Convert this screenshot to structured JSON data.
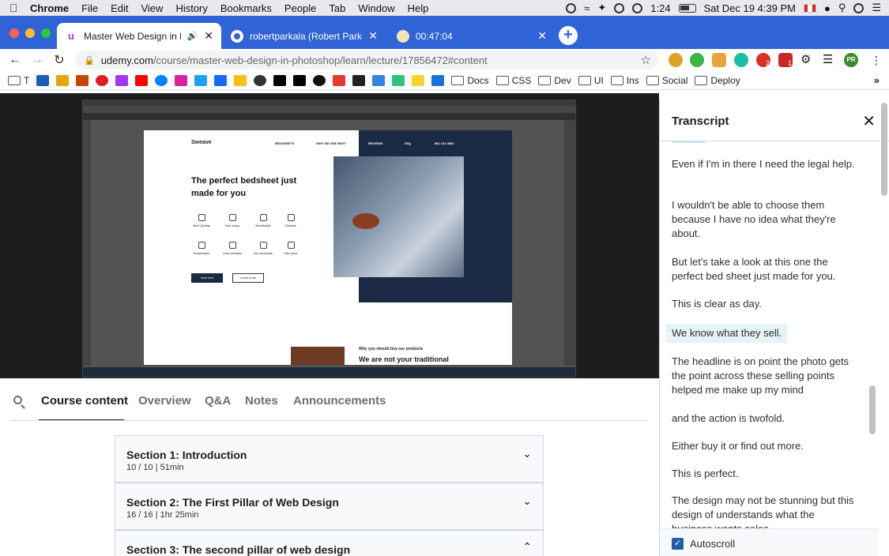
{
  "menubar": {
    "app": "Chrome",
    "items": [
      "File",
      "Edit",
      "View",
      "History",
      "Bookmarks",
      "People",
      "Tab",
      "Window",
      "Help"
    ],
    "timer": "1:24",
    "clock": "Sat Dec 19  4:39 PM"
  },
  "tabs": [
    {
      "title": "Master Web Design in Pho",
      "active": true
    },
    {
      "title": "robertparkala (Robert Parkala)",
      "active": false
    },
    {
      "title": "00:47:04",
      "active": false
    }
  ],
  "address": {
    "host": "udemy.com",
    "path": "/course/master-web-design-in-photoshop/learn/lecture/17856472#content"
  },
  "extensions": {
    "profile_badge": "PR",
    "badge_count_1": "2",
    "badge_count_2": "1"
  },
  "bookmarks": {
    "first": "T",
    "folders": [
      "Docs",
      "CSS",
      "Dev",
      "UI",
      "Ins",
      "Social",
      "Deploy"
    ],
    "more": "»"
  },
  "video": {
    "canvas": {
      "logo": "Sweave",
      "nav": [
        "BEDSHEETS",
        "WHY WE ARE BEST",
        "REVIEWS",
        "FAQ",
        "861 123 4562"
      ],
      "headline": "The perfect bedsheet just made for you",
      "features": [
        "Best Quality",
        "Non-shiny",
        "Breathable",
        "Durable",
        "Sustainable",
        "Less wrinkles",
        "No chemicals",
        "Fair price"
      ],
      "primary_button": "SHOP NOW",
      "secondary_button": "LEARN MORE",
      "sub_eyebrow": "Why you should buy our products",
      "sub_heading": "We are not your traditional"
    }
  },
  "course_tabs": {
    "items": [
      "Course content",
      "Overview",
      "Q&A",
      "Notes",
      "Announcements"
    ],
    "active": "Course content"
  },
  "sections": [
    {
      "title": "Section 1: Introduction",
      "meta": "10 / 10 | 51min",
      "expanded": false
    },
    {
      "title": "Section 2: The First Pillar of Web Design",
      "meta": "16 / 16 | 1hr 25min",
      "expanded": false
    },
    {
      "title": "Section 3: The second pillar of web design",
      "meta": "",
      "expanded": true
    }
  ],
  "transcript": {
    "title": "Transcript",
    "cues": [
      "Even if I'm in there I need the legal help.",
      "I wouldn't be able to choose them because I have no idea what they're about.",
      "But let's take a look at this one the perfect bed sheet just made for you.",
      "This is clear as day.",
      "We know what they sell.",
      "The headline is on point the photo gets the point across these selling points helped me make up my mind",
      "and the action is twofold.",
      "Either buy it or find out more.",
      "This is perfect.",
      "The design may not be stunning but this design of understands what the business wants sales."
    ],
    "highlighted_index": 4,
    "autoscroll_label": "Autoscroll",
    "autoscroll_checked": true
  }
}
